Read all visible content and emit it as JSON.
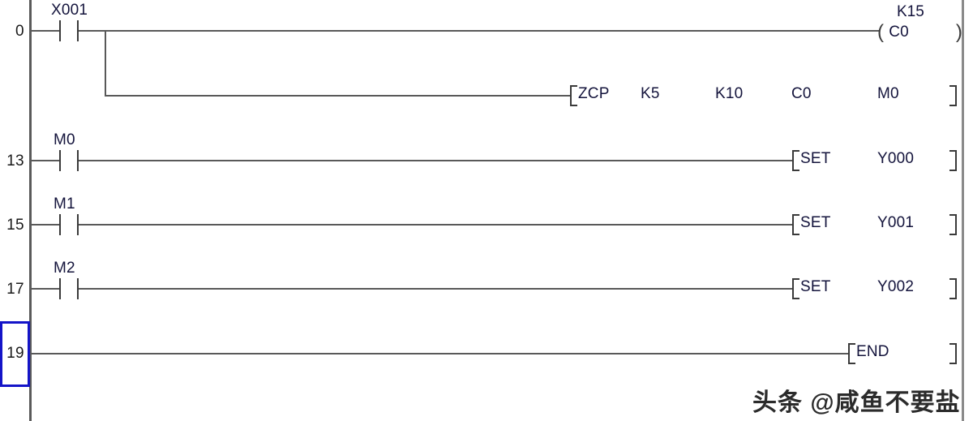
{
  "editor": {
    "type": "plc-ladder-diagram",
    "rail_color": "#5a5a5a",
    "wire_color": "#595959",
    "text_color": "#14143c",
    "selection_color": "#1414c8"
  },
  "rungs": [
    {
      "line_number": "0",
      "contact": {
        "label": "X001",
        "type": "normally-open"
      },
      "coil": {
        "open": "(",
        "label": "C0",
        "close": ")",
        "preset": "K15"
      }
    },
    {
      "line_number": "",
      "instruction": {
        "open": "[",
        "close": "]",
        "mnemonic": "ZCP",
        "operands": [
          "K5",
          "K10",
          "C0",
          "M0"
        ]
      }
    },
    {
      "line_number": "13",
      "contact": {
        "label": "M0",
        "type": "normally-open"
      },
      "instruction": {
        "open": "[",
        "close": "]",
        "mnemonic": "SET",
        "operands": [
          "Y000"
        ]
      }
    },
    {
      "line_number": "15",
      "contact": {
        "label": "M1",
        "type": "normally-open"
      },
      "instruction": {
        "open": "[",
        "close": "]",
        "mnemonic": "SET",
        "operands": [
          "Y001"
        ]
      }
    },
    {
      "line_number": "17",
      "contact": {
        "label": "M2",
        "type": "normally-open"
      },
      "instruction": {
        "open": "[",
        "close": "]",
        "mnemonic": "SET",
        "operands": [
          "Y002"
        ]
      }
    },
    {
      "line_number": "19",
      "selected": true,
      "instruction": {
        "open": "[",
        "close": "]",
        "mnemonic": "END",
        "operands": []
      }
    }
  ],
  "watermark": {
    "text": "头条 @咸鱼不要盐"
  }
}
